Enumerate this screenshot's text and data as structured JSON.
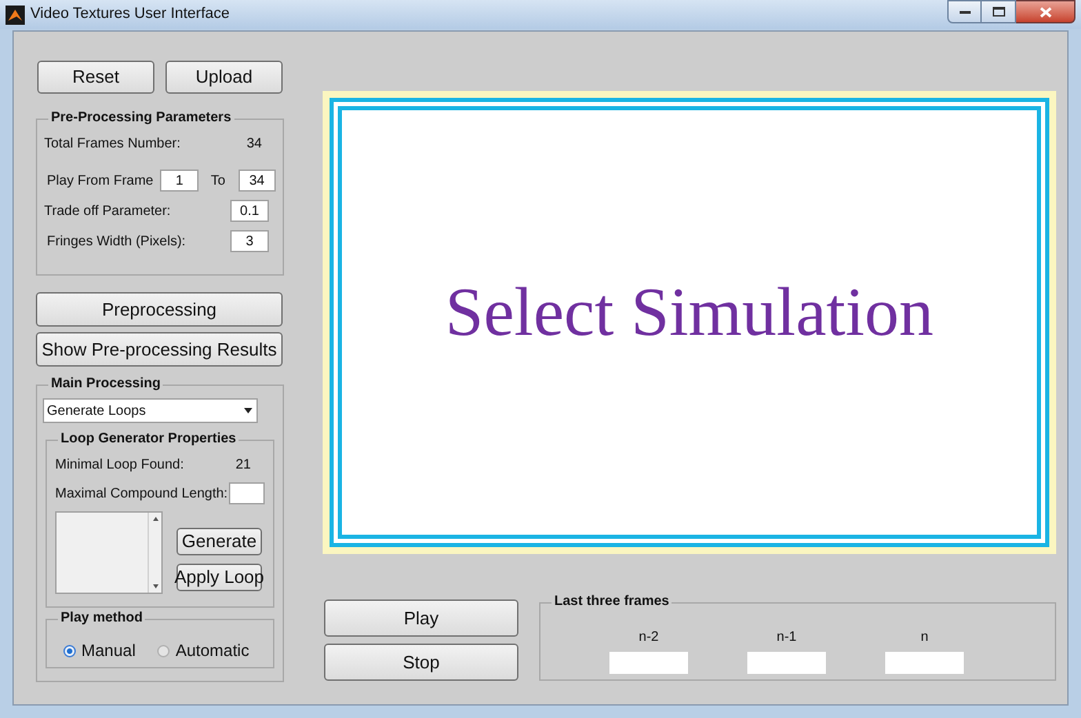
{
  "window": {
    "title": "Video Textures User Interface"
  },
  "top_buttons": [
    {
      "label": "Reset"
    },
    {
      "label": "Upload"
    }
  ],
  "preprocessing_parameters": {
    "title": "Pre-Processing Parameters",
    "total_frames_label": "Total Frames Number:",
    "total_frames_value": "34",
    "play_from_label": "Play From Frame",
    "from_value": "1",
    "to_label": "To",
    "to_value": "34",
    "trade_off_label": "Trade off Parameter:",
    "trade_off_value": "0.1",
    "fringes_label": "Fringes Width (Pixels):",
    "fringes_value": "3"
  },
  "action_buttons": [
    {
      "label": "Preprocessing"
    },
    {
      "label": "Show Pre-processing Results"
    }
  ],
  "main_processing": {
    "title": "Main Processing",
    "dropdown": "Generate Loops",
    "loop_generator": {
      "title": "Loop Generator Properties",
      "minimal_label": "Minimal Loop Found:",
      "minimal_value": "21",
      "maximal_label": "Maximal Compound Length:",
      "buttons": [
        {
          "label": "Generate"
        },
        {
          "label": "Apply Loop"
        }
      ]
    },
    "play_method": {
      "title": "Play method",
      "options": [
        {
          "label": "Manual",
          "selected": true
        },
        {
          "label": "Automatic",
          "selected": false
        }
      ]
    }
  },
  "display": {
    "text": "Select Simulation"
  },
  "playback_buttons": [
    {
      "label": "Play"
    },
    {
      "label": "Stop"
    }
  ],
  "last_frames": {
    "title": "Last three frames",
    "frames": [
      {
        "label": "n-2"
      },
      {
        "label": "n-1"
      },
      {
        "label": "n"
      }
    ]
  }
}
